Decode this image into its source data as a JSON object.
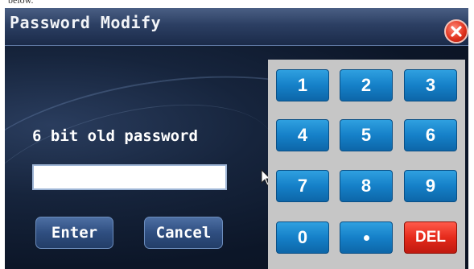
{
  "window": {
    "title": "Password Modify",
    "above_text": "below."
  },
  "form": {
    "old_password_label": "6 bit old password",
    "password_value": "",
    "enter_label": "Enter",
    "cancel_label": "Cancel"
  },
  "keypad": {
    "keys": [
      "1",
      "2",
      "3",
      "4",
      "5",
      "6",
      "7",
      "8",
      "9",
      "0",
      "•",
      "DEL"
    ]
  },
  "icons": {
    "close": "close-icon",
    "cursor": "mouse-pointer-icon"
  },
  "colors": {
    "title_bar": "#2c3f63",
    "key_blue": "#1580c8",
    "key_delete": "#e52a1b",
    "close_red": "#e2341f",
    "keypad_panel": "#c6c6c6"
  }
}
